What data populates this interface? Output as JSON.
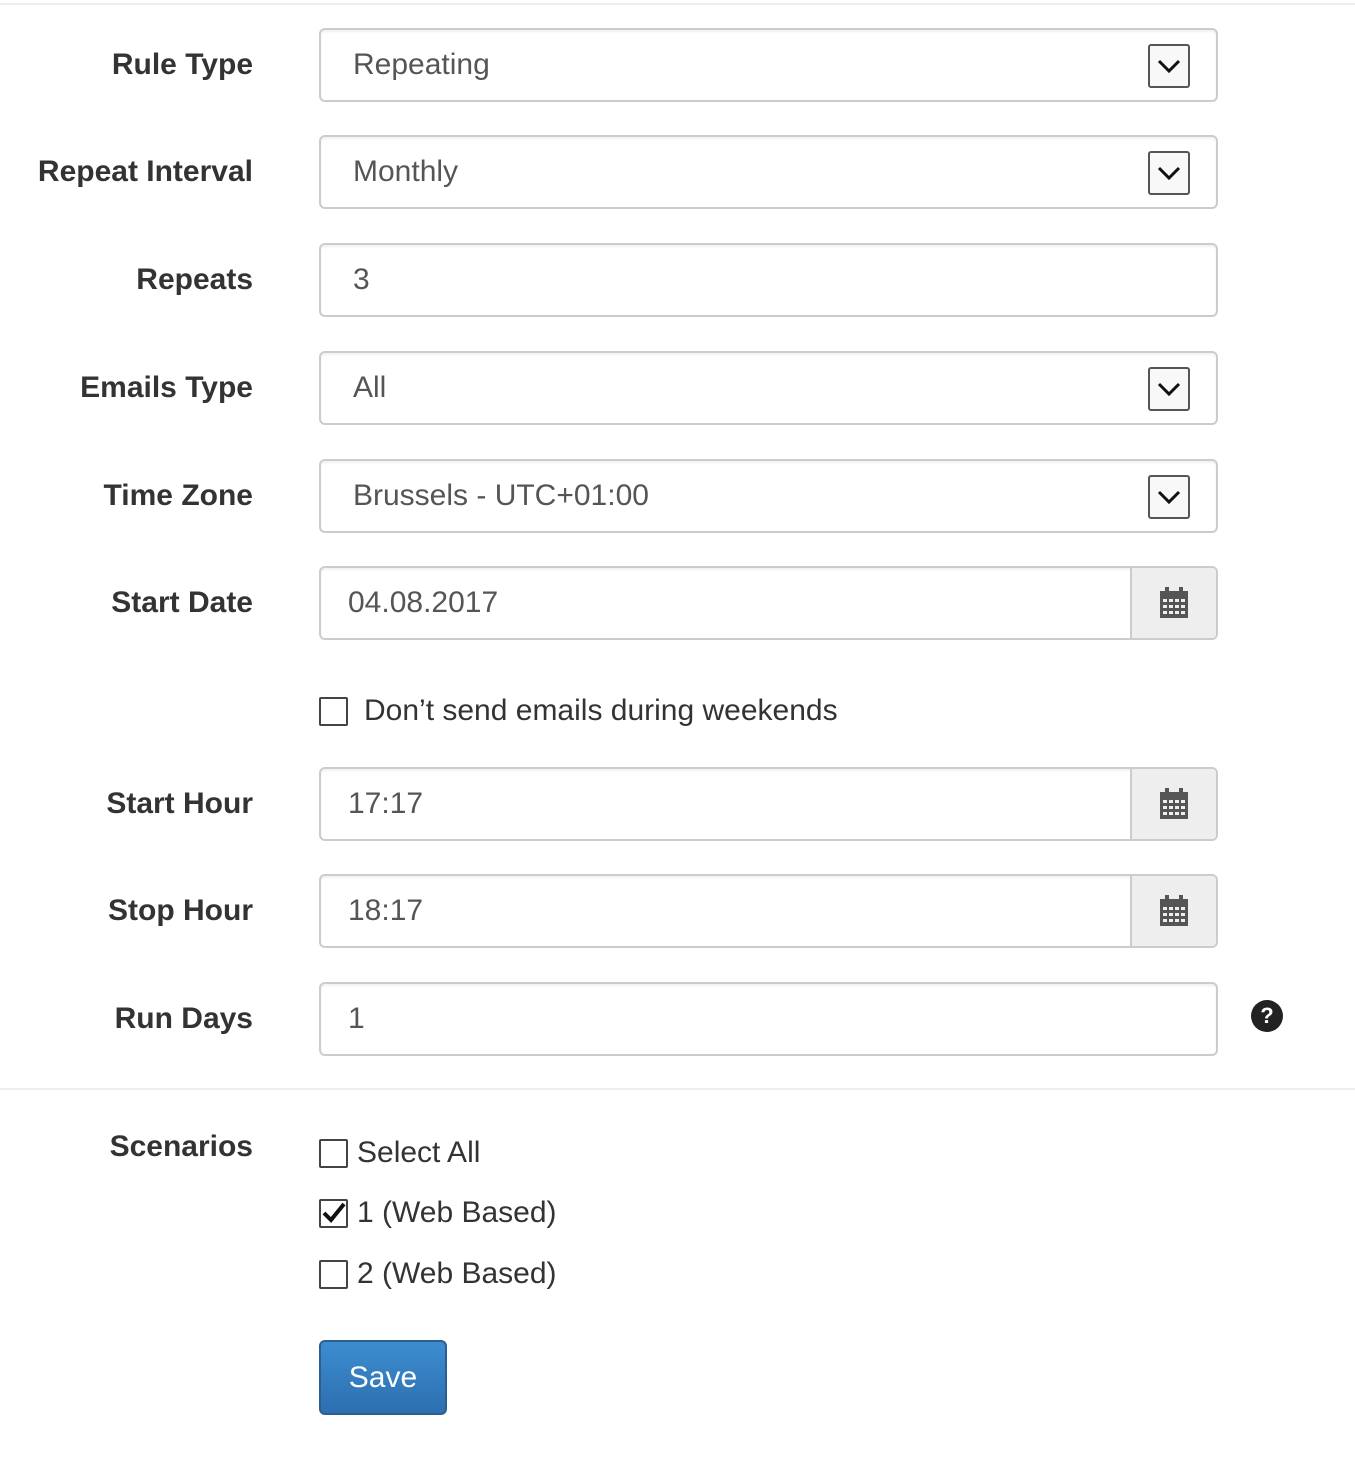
{
  "form": {
    "rule_type": {
      "label": "Rule Type",
      "value": "Repeating"
    },
    "repeat_interval": {
      "label": "Repeat Interval",
      "value": "Monthly"
    },
    "repeats": {
      "label": "Repeats",
      "value": "3"
    },
    "emails_type": {
      "label": "Emails Type",
      "value": "All"
    },
    "time_zone": {
      "label": "Time Zone",
      "value": "Brussels - UTC+01:00"
    },
    "start_date": {
      "label": "Start Date",
      "value": "04.08.2017"
    },
    "weekends": {
      "label": "Don’t send emails during weekends",
      "checked": false
    },
    "start_hour": {
      "label": "Start Hour",
      "value": "17:17"
    },
    "stop_hour": {
      "label": "Stop Hour",
      "value": "18:17"
    },
    "run_days": {
      "label": "Run Days",
      "value": "1",
      "help_icon": "question-circle-icon"
    }
  },
  "scenarios": {
    "label": "Scenarios",
    "items": [
      {
        "label": "Select All",
        "checked": false
      },
      {
        "label": "1 (Web Based)",
        "checked": true
      },
      {
        "label": "2 (Web Based)",
        "checked": false
      }
    ]
  },
  "save_label": "Save",
  "colors": {
    "accent": "#337ab7",
    "border": "#cccccc",
    "addon_bg": "#eeeeee"
  }
}
